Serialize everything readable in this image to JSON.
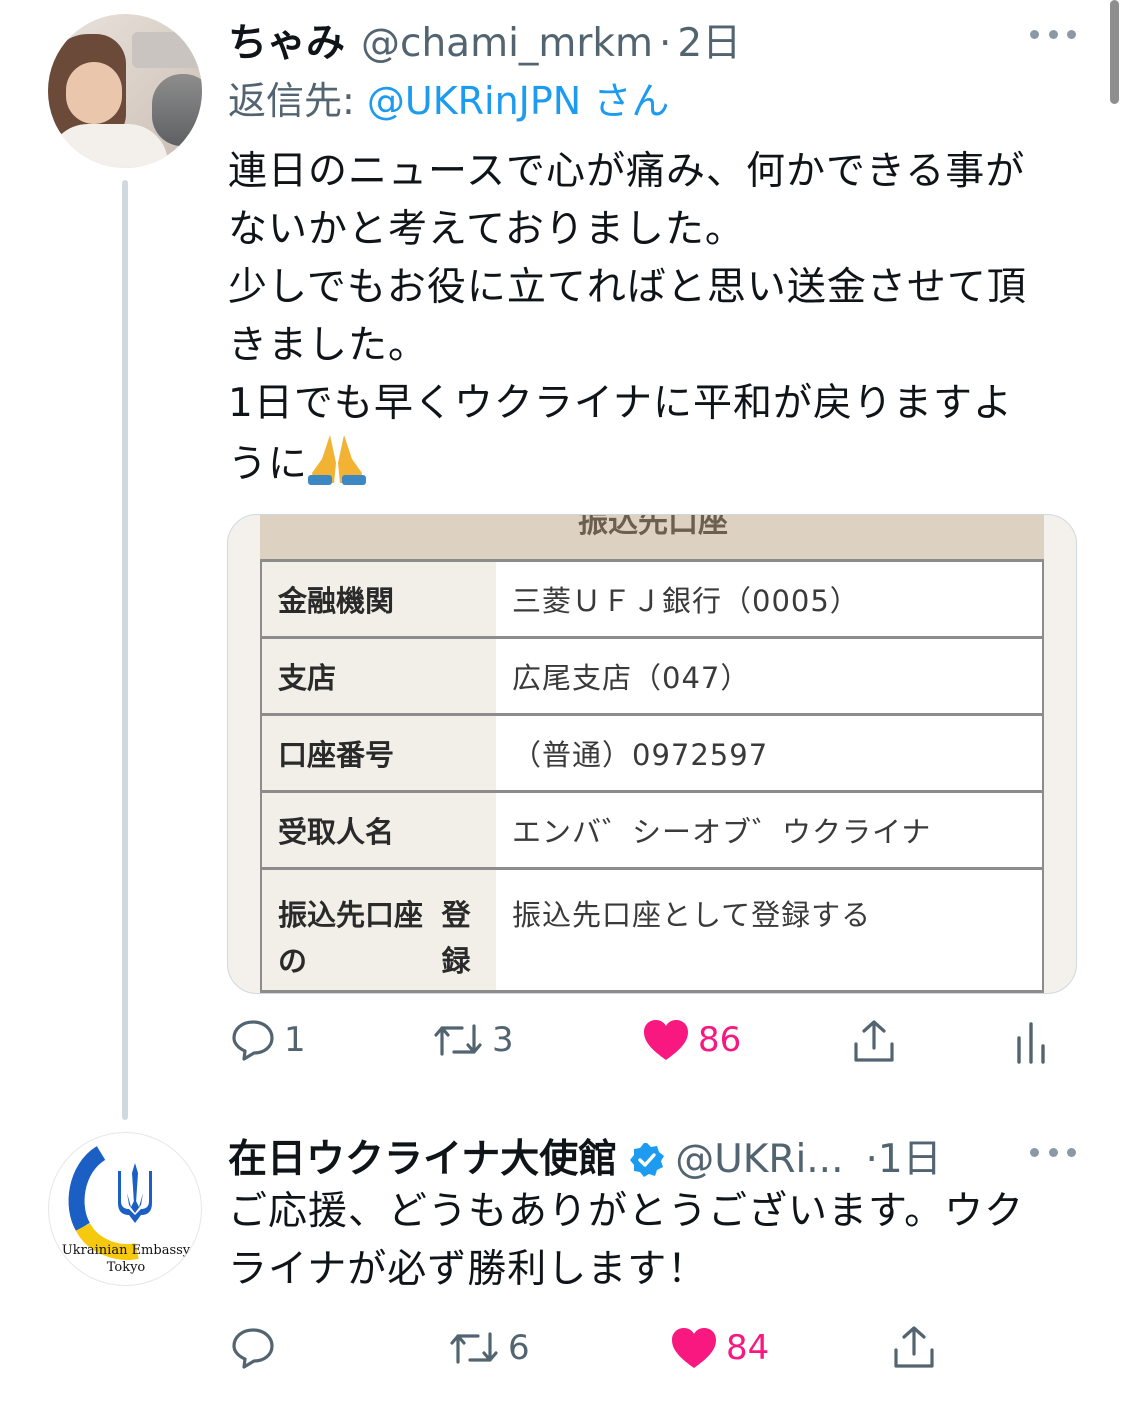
{
  "tweet1": {
    "display_name": "ちゃみ",
    "handle": "@chami_mrkm",
    "separator": "·",
    "time": "2日",
    "reply_prefix": "返信先:",
    "reply_mention": "@UKRinJPN",
    "reply_suffix": "さん",
    "text_lines": [
      "連日のニュースで心が痛み、何かできる事が",
      "ないかと考えておりました。",
      "少しでもお役に立てればと思い送金させて頂",
      "きました。",
      "1日でも早くウクライナに平和が戻りますよ",
      "うに"
    ],
    "emoji_icon": "folded-hands-emoji",
    "image": {
      "header_text": "振込先口座",
      "rows": [
        {
          "label": "金融機関",
          "value": "三菱ＵＦＪ銀行（0005）"
        },
        {
          "label": "支店",
          "value": "広尾支店（047）"
        },
        {
          "label": "口座番号",
          "value": "（普通）0972597"
        },
        {
          "label": "受取人名",
          "value": "エンバ゛シーオブ゛ウクライナ"
        },
        {
          "label_line1": "振込先口座の",
          "label_line2": "登録",
          "value": "振込先口座として登録する"
        }
      ]
    },
    "actions": {
      "reply_count": "1",
      "retweet_count": "3",
      "like_count": "86"
    }
  },
  "tweet2": {
    "display_name": "在日ウクライナ大使館",
    "verified_icon": "verified-badge-icon",
    "handle": "@UKRi...",
    "time": "·1日",
    "text_lines": [
      "ご応援、どうもありがとうございます。ウク",
      "ライナが必ず勝利します！"
    ],
    "avatar_caption_line1": "Ukrainian Embassy",
    "avatar_caption_line2": "Tokyo",
    "actions": {
      "retweet_count": "6",
      "like_count": "84"
    }
  },
  "colors": {
    "link_blue": "#1d9bf0",
    "muted_gray": "#536471",
    "like_pink": "#f91880",
    "thread_line": "#cfd9de"
  }
}
